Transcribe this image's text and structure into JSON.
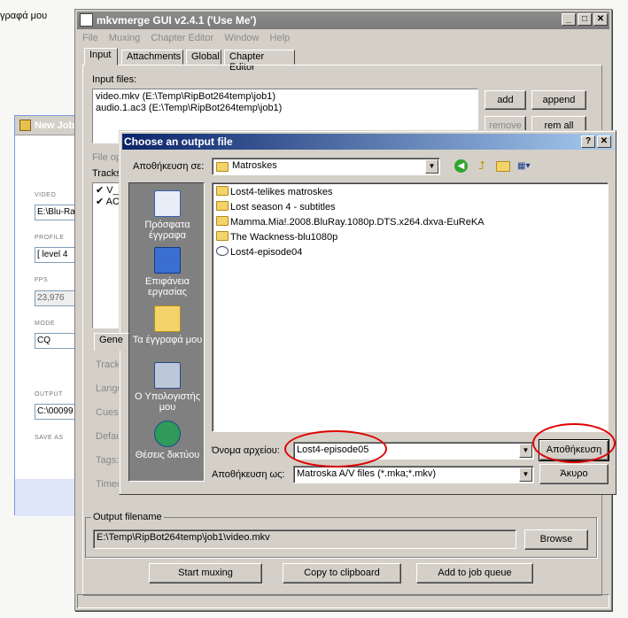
{
  "desktop": {
    "label": "γραφά μου"
  },
  "bgjob": {
    "title": "New Job",
    "video_label": "VIDEO",
    "video_value": "E:\\Blu-Ra",
    "profile_label": "PROFILE",
    "profile_value": "[ level 4",
    "fps_label": "FPS",
    "fps_value": "23,976",
    "mode_label": "MODE",
    "mode_value": "CQ",
    "output_label": "OUTPUT",
    "output_value": "C:\\00099",
    "saveas_label": "SAVE AS"
  },
  "main": {
    "title": "mkvmerge GUI v2.4.1 ('Use Me')",
    "menu": [
      "File",
      "Muxing",
      "Chapter Editor",
      "Window",
      "Help"
    ],
    "tabs": [
      "Input",
      "Attachments",
      "Global",
      "Chapter Editor"
    ],
    "input_files_label": "Input files:",
    "input_files": [
      "video.mkv (E:\\Temp\\RipBot264temp\\job1)",
      "audio.1.ac3 (E:\\Temp\\RipBot264temp\\job1)"
    ],
    "buttons": {
      "add": "add",
      "append": "append",
      "remove": "remove",
      "remall": "rem all"
    },
    "file_options_label": "File op",
    "tracks_label": "Tracks",
    "tracks": [
      "V_",
      "AC"
    ],
    "general_tab": "Gene",
    "side_labels": [
      "Track",
      "Langu",
      "Cues:",
      "Defau",
      "Tags:",
      "Timec"
    ],
    "output_group": "Output filename",
    "output_value": "E:\\Temp\\RipBot264temp\\job1\\video.mkv",
    "browse": "Browse",
    "start": "Start muxing",
    "copy": "Copy to clipboard",
    "queue": "Add to job queue"
  },
  "dialog": {
    "title": "Choose an output file",
    "save_in_label": "Αποθήκευση σε:",
    "save_in_value": "Matroskes",
    "places": [
      "Πρόσφατα έγγραφα",
      "Επιφάνεια εργασίας",
      "Τα έγγραφά μου",
      "Ο Υπολογιστής μου",
      "Θέσεις δικτύου"
    ],
    "files": [
      {
        "name": "Lost4-telikes matroskes",
        "icon": "folder-icon"
      },
      {
        "name": "Lost season 4 - subtitles",
        "icon": "folder-icon"
      },
      {
        "name": "Mamma.Mia!.2008.BluRay.1080p.DTS.x264.dxva-EuReKA",
        "icon": "folder-icon"
      },
      {
        "name": "The Wackness-blu1080p",
        "icon": "folder-icon"
      },
      {
        "name": "Lost4-episode04",
        "icon": "mkv-file-icon"
      }
    ],
    "filename_label": "Όνομα αρχείου:",
    "filename_value": "Lost4-episode05",
    "saveas_label": "Αποθήκευση ως:",
    "saveas_value": "Matroska A/V files (*.mka;*.mkv)",
    "save_button": "Αποθήκευση",
    "cancel_button": "Άκυρο",
    "help_btn": "?",
    "close_btn": "✕"
  },
  "colors": {
    "annotation": "#e00000",
    "dialog_title": "#0a246a"
  }
}
